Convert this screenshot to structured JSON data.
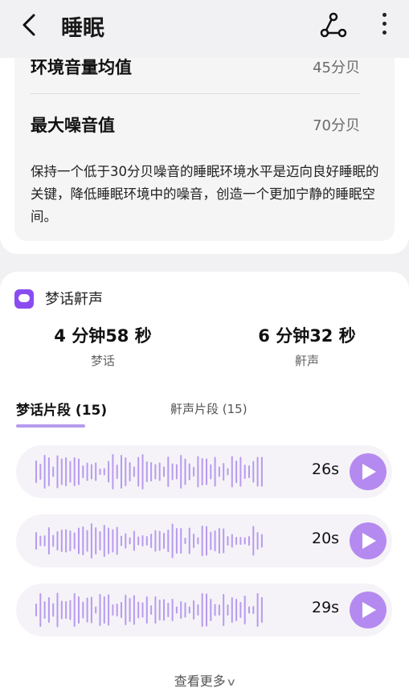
{
  "header": {
    "title": "睡眠"
  },
  "noise": {
    "rows": [
      {
        "label": "环境音量均值",
        "value": "45分贝"
      },
      {
        "label": "最大噪音值",
        "value": "70分贝"
      }
    ],
    "advice": "保持一个低于30分贝噪音的睡眠环境水平是迈向良好睡眠的关键，降低睡眠环境中的噪音，创造一个更加宁静的睡眠空间。"
  },
  "dream": {
    "title": "梦话鼾声",
    "stats": [
      {
        "value": "4 分钟58 秒",
        "caption": "梦话"
      },
      {
        "value": "6 分钟32 秒",
        "caption": "鼾声"
      }
    ],
    "tabs": [
      {
        "label": "梦话片段 (15)",
        "active": true
      },
      {
        "label": "鼾声片段 (15)",
        "active": false
      }
    ],
    "clips": [
      {
        "duration": "26s"
      },
      {
        "duration": "20s"
      },
      {
        "duration": "29s"
      }
    ],
    "see_more": "查看更多"
  },
  "colors": {
    "accent": "#b58af0",
    "icon": "#8a4cf0",
    "waveform": "#b79bee"
  }
}
